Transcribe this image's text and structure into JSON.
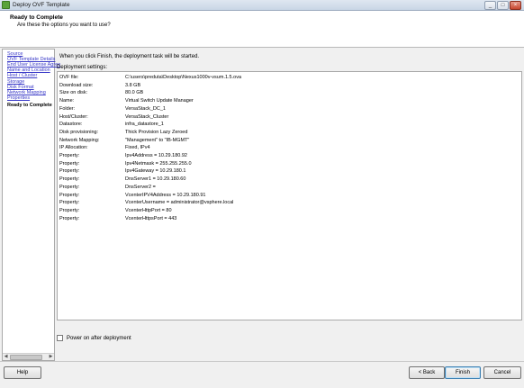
{
  "window": {
    "title": "Deploy OVF Template",
    "controls": [
      "minimize-icon",
      "maximize-icon",
      "close-icon"
    ]
  },
  "header": {
    "title": "Ready to Complete",
    "subtitle": "Are these the options you want to use?"
  },
  "sidebar": {
    "items": [
      {
        "label": "Source",
        "active": false
      },
      {
        "label": "OVF Template Details",
        "active": false
      },
      {
        "label": "End User License Agree",
        "active": false
      },
      {
        "label": "Name and Location",
        "active": false
      },
      {
        "label": "Host / Cluster",
        "active": false
      },
      {
        "label": "Storage",
        "active": false
      },
      {
        "label": "Disk Format",
        "active": false
      },
      {
        "label": "Network Mapping",
        "active": false
      },
      {
        "label": "Properties",
        "active": false
      },
      {
        "label": "Ready to Complete",
        "active": true
      }
    ]
  },
  "main": {
    "intro": "When you click Finish, the deployment task will be started.",
    "settings_label": "Deployment settings:",
    "settings": [
      {
        "key": "OVF file:",
        "value": "C:\\users\\preduta\\Desktop\\Nexus1000v-vsum.1.5.ova"
      },
      {
        "key": "Download size:",
        "value": "3.8 GB"
      },
      {
        "key": "Size on disk:",
        "value": "80.0 GB"
      },
      {
        "key": "Name:",
        "value": "Virtual Switch Update Manager"
      },
      {
        "key": "Folder:",
        "value": "VersaStack_DC_1"
      },
      {
        "key": "Host/Cluster:",
        "value": "VersaStack_Cluster"
      },
      {
        "key": "Datastore:",
        "value": "infra_datastore_1"
      },
      {
        "key": "Disk provisioning:",
        "value": "Thick Provision Lazy Zeroed"
      },
      {
        "key": "Network Mapping:",
        "value": "\"Management\" to \"IB-MGMT\""
      },
      {
        "key": "IP Allocation:",
        "value": "Fixed, IPv4"
      },
      {
        "key": "Property:",
        "value": "Ipv4Address = 10.29.180.92"
      },
      {
        "key": "Property:",
        "value": "Ipv4Netmask = 255.255.255.0"
      },
      {
        "key": "Property:",
        "value": "Ipv4Gateway = 10.29.180.1"
      },
      {
        "key": "Property:",
        "value": "DnsServer1 = 10.29.180.60"
      },
      {
        "key": "Property:",
        "value": "DnsServer2 ="
      },
      {
        "key": "Property:",
        "value": "VcenterIPV4Address = 10.29.180.91"
      },
      {
        "key": "Property:",
        "value": "VcenterUsername = administrator@vsphere.local"
      },
      {
        "key": "Property:",
        "value": "VcenterHttpPort = 80"
      },
      {
        "key": "Property:",
        "value": "VcenterHttpsPort = 443"
      }
    ],
    "power_on_label": "Power on after deployment",
    "power_on_checked": false
  },
  "footer": {
    "help_label": "Help",
    "back_label": "< Back",
    "finish_label": "Finish",
    "cancel_label": "Cancel"
  }
}
